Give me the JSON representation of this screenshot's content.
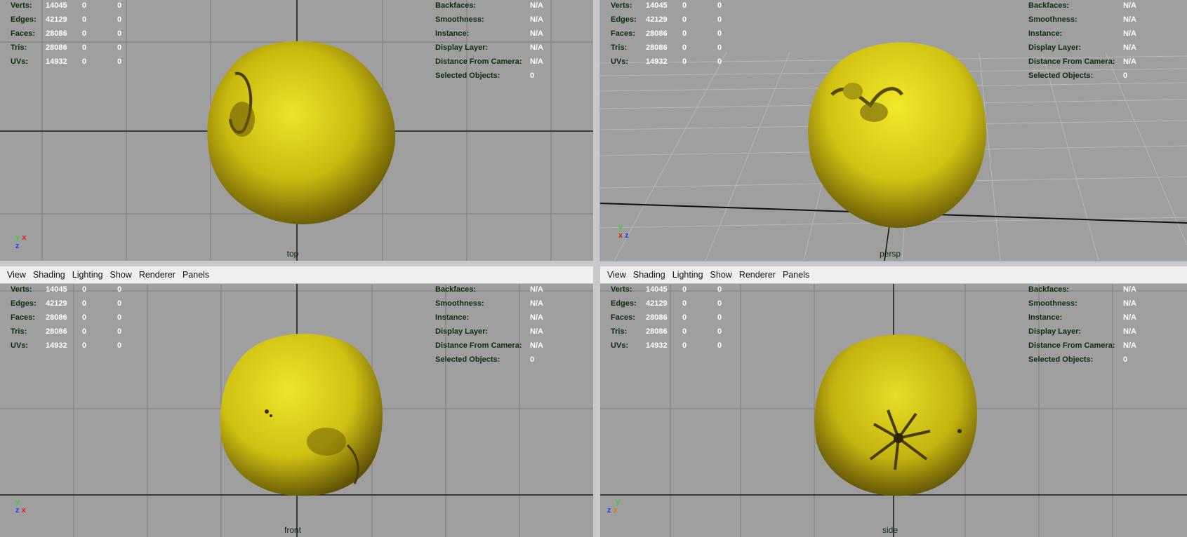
{
  "stats": {
    "rows": [
      {
        "label": "Verts:",
        "v1": "14045",
        "v2": "0",
        "v3": "0"
      },
      {
        "label": "Edges:",
        "v1": "42129",
        "v2": "0",
        "v3": "0"
      },
      {
        "label": "Faces:",
        "v1": "28086",
        "v2": "0",
        "v3": "0"
      },
      {
        "label": "Tris:",
        "v1": "28086",
        "v2": "0",
        "v3": "0"
      },
      {
        "label": "UVs:",
        "v1": "14932",
        "v2": "0",
        "v3": "0"
      }
    ]
  },
  "info": {
    "rows": [
      {
        "label": "Backfaces:",
        "value": "N/A"
      },
      {
        "label": "Smoothness:",
        "value": "N/A"
      },
      {
        "label": "Instance:",
        "value": "N/A"
      },
      {
        "label": "Display Layer:",
        "value": "N/A"
      },
      {
        "label": "Distance From Camera:",
        "value": "N/A"
      },
      {
        "label": "Selected Objects:",
        "value": "0"
      }
    ]
  },
  "menu": [
    "View",
    "Shading",
    "Lighting",
    "Show",
    "Renderer",
    "Panels"
  ],
  "viewports": {
    "top": {
      "camera": "top",
      "axes": {
        "a": "y",
        "b": "x",
        "c": "z"
      }
    },
    "persp": {
      "camera": "persp",
      "axes": {
        "a": "y",
        "b": "x",
        "c": "z"
      }
    },
    "front": {
      "camera": "front",
      "axes": {
        "a": "y",
        "b": "z",
        "c": "x"
      }
    },
    "side": {
      "camera": "side",
      "axes": {
        "a": "y",
        "b": "z",
        "c": "x"
      }
    }
  },
  "colors": {
    "viewport_bg": "#9f9f9f",
    "fruit": "#d8cf16",
    "hud_label": "#0d2d10",
    "hud_value": "#ffffff",
    "axis_x": "#e01a1a",
    "axis_y": "#31d331",
    "axis_z": "#2a3bff"
  }
}
